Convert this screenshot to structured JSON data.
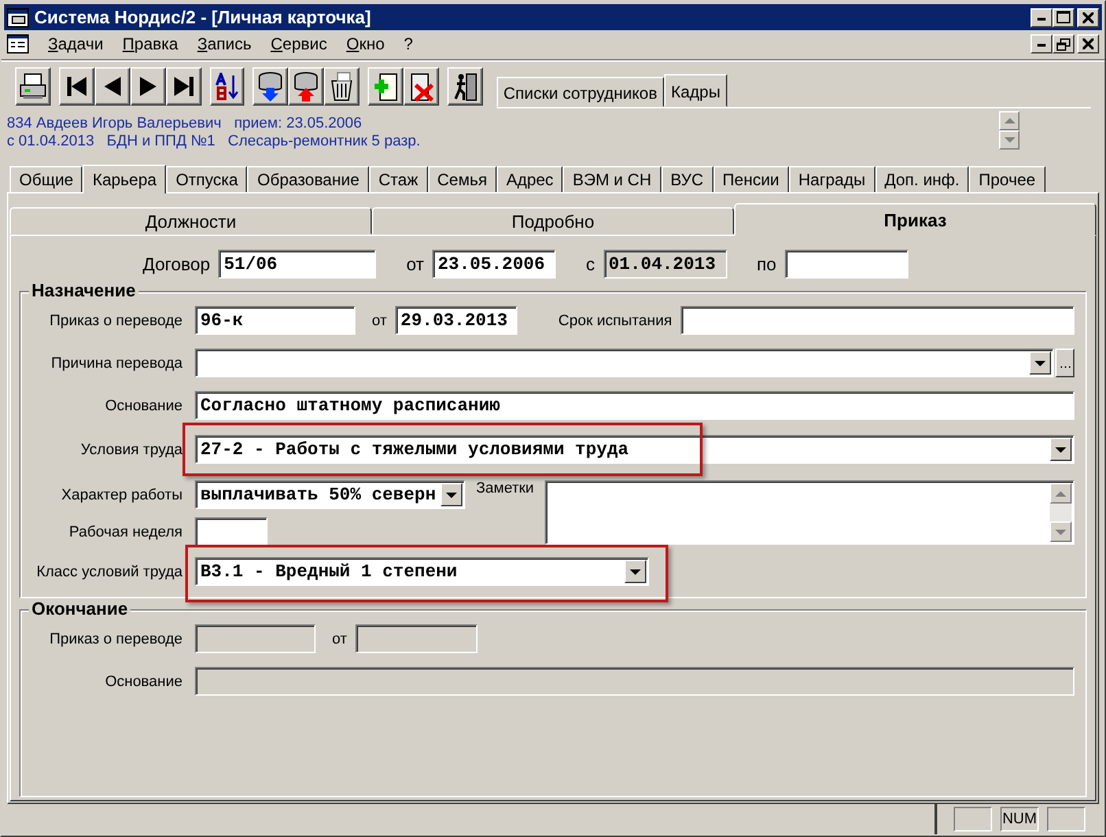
{
  "window": {
    "title": "Система Нордис/2 - [Личная карточка]"
  },
  "menu": [
    "Задачи",
    "Правка",
    "Запись",
    "Сервис",
    "Окно",
    "?"
  ],
  "toolbar_tabs": [
    {
      "label": "Списки сотрудников",
      "selected": false
    },
    {
      "label": "Кадры",
      "selected": true
    }
  ],
  "employee_info": {
    "line_1": "834 Авдеев Игорь Валерьевич   прием: 23.05.2006",
    "line_2": "с 01.04.2013   БДН и ППД №1   Слесарь-ремонтник 5 разр."
  },
  "tabs": [
    {
      "label": "Общие",
      "selected": false
    },
    {
      "label": "Карьера",
      "selected": true
    },
    {
      "label": "Отпуска",
      "selected": false
    },
    {
      "label": "Образование",
      "selected": false
    },
    {
      "label": "Стаж",
      "selected": false
    },
    {
      "label": "Семья",
      "selected": false
    },
    {
      "label": "Адрес",
      "selected": false
    },
    {
      "label": "ВЭМ и СН",
      "selected": false
    },
    {
      "label": "ВУС",
      "selected": false
    },
    {
      "label": "Пенсии",
      "selected": false
    },
    {
      "label": "Награды",
      "selected": false
    },
    {
      "label": "Доп. инф.",
      "selected": false
    },
    {
      "label": "Прочее",
      "selected": false
    }
  ],
  "subtabs": [
    {
      "label": "Должности",
      "selected": false
    },
    {
      "label": "Подробно",
      "selected": false
    },
    {
      "label": "Приказ",
      "selected": true
    }
  ],
  "contract": {
    "label": "Договор",
    "number": "51/06",
    "from_label": "от",
    "from_date": "23.05.2006",
    "since_label": "с",
    "since_date": "01.04.2013",
    "to_label": "по"
  },
  "assignment": {
    "title": "Назначение",
    "order": {
      "label": "Приказ о переводе",
      "value": "96-к",
      "date_label": "от",
      "date": "29.03.2013",
      "probation_label": "Срок испытания"
    },
    "reason": {
      "label": "Причина перевода"
    },
    "basis": {
      "label": "Основание",
      "value": "Согласно штатному расписанию"
    },
    "conditions": {
      "label": "Условия труда",
      "value": "27-2 - Работы с тяжелыми условиями труда",
      "highlighted": true
    },
    "work_nature": {
      "label": "Характер работы",
      "value": "выплачивать 50% северн"
    },
    "notes": {
      "label": "Заметки"
    },
    "work_week": {
      "label": "Рабочая неделя"
    },
    "condition_class": {
      "label": "Класс условий труда",
      "value": "В3.1 - Вредный 1 степени",
      "highlighted": true
    }
  },
  "termination": {
    "title": "Окончание",
    "order_label": "Приказ о переводе",
    "date_label": "от",
    "basis_label": "Основание",
    "disabled": true
  },
  "status_bar": {
    "indicator": "NUM"
  }
}
